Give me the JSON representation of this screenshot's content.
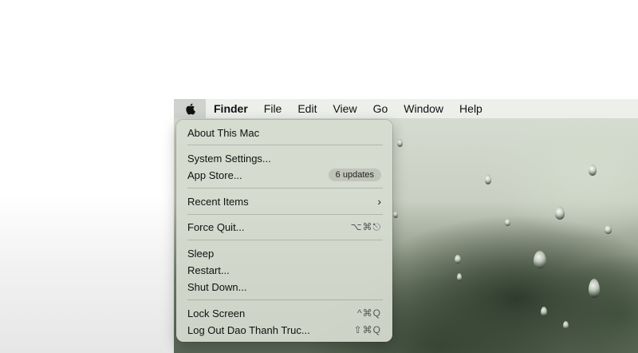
{
  "menubar": {
    "apple_icon": "apple-logo-icon",
    "items": [
      "Finder",
      "File",
      "Edit",
      "View",
      "Go",
      "Window",
      "Help"
    ]
  },
  "apple_menu": {
    "about": "About This Mac",
    "system_settings": "System Settings...",
    "app_store": "App Store...",
    "app_store_badge": "6 updates",
    "recent_items": "Recent Items",
    "recent_items_chevron": "›",
    "force_quit": "Force Quit...",
    "force_quit_shortcut": "⌥⌘⎋",
    "sleep": "Sleep",
    "restart": "Restart...",
    "shut_down": "Shut Down...",
    "lock_screen": "Lock Screen",
    "lock_screen_shortcut": "^⌘Q",
    "log_out": "Log Out Dao Thanh Truc...",
    "log_out_shortcut": "⇧⌘Q"
  },
  "colors": {
    "menu_background": "#d6dcd0",
    "menubar_background": "#eef0eb",
    "text": "#111111"
  }
}
